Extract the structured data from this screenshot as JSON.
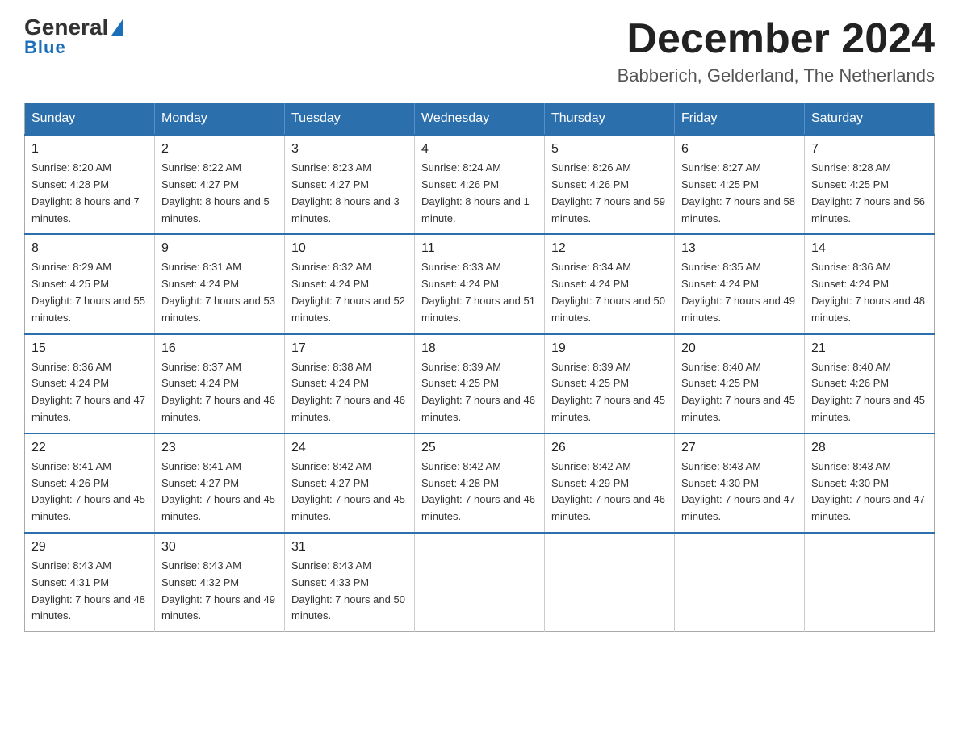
{
  "logo": {
    "general": "General",
    "blue": "Blue",
    "arrow": "▶"
  },
  "title": {
    "month_year": "December 2024",
    "location": "Babberich, Gelderland, The Netherlands"
  },
  "weekdays": [
    "Sunday",
    "Monday",
    "Tuesday",
    "Wednesday",
    "Thursday",
    "Friday",
    "Saturday"
  ],
  "weeks": [
    [
      {
        "day": "1",
        "sunrise": "8:20 AM",
        "sunset": "4:28 PM",
        "daylight": "8 hours and 7 minutes."
      },
      {
        "day": "2",
        "sunrise": "8:22 AM",
        "sunset": "4:27 PM",
        "daylight": "8 hours and 5 minutes."
      },
      {
        "day": "3",
        "sunrise": "8:23 AM",
        "sunset": "4:27 PM",
        "daylight": "8 hours and 3 minutes."
      },
      {
        "day": "4",
        "sunrise": "8:24 AM",
        "sunset": "4:26 PM",
        "daylight": "8 hours and 1 minute."
      },
      {
        "day": "5",
        "sunrise": "8:26 AM",
        "sunset": "4:26 PM",
        "daylight": "7 hours and 59 minutes."
      },
      {
        "day": "6",
        "sunrise": "8:27 AM",
        "sunset": "4:25 PM",
        "daylight": "7 hours and 58 minutes."
      },
      {
        "day": "7",
        "sunrise": "8:28 AM",
        "sunset": "4:25 PM",
        "daylight": "7 hours and 56 minutes."
      }
    ],
    [
      {
        "day": "8",
        "sunrise": "8:29 AM",
        "sunset": "4:25 PM",
        "daylight": "7 hours and 55 minutes."
      },
      {
        "day": "9",
        "sunrise": "8:31 AM",
        "sunset": "4:24 PM",
        "daylight": "7 hours and 53 minutes."
      },
      {
        "day": "10",
        "sunrise": "8:32 AM",
        "sunset": "4:24 PM",
        "daylight": "7 hours and 52 minutes."
      },
      {
        "day": "11",
        "sunrise": "8:33 AM",
        "sunset": "4:24 PM",
        "daylight": "7 hours and 51 minutes."
      },
      {
        "day": "12",
        "sunrise": "8:34 AM",
        "sunset": "4:24 PM",
        "daylight": "7 hours and 50 minutes."
      },
      {
        "day": "13",
        "sunrise": "8:35 AM",
        "sunset": "4:24 PM",
        "daylight": "7 hours and 49 minutes."
      },
      {
        "day": "14",
        "sunrise": "8:36 AM",
        "sunset": "4:24 PM",
        "daylight": "7 hours and 48 minutes."
      }
    ],
    [
      {
        "day": "15",
        "sunrise": "8:36 AM",
        "sunset": "4:24 PM",
        "daylight": "7 hours and 47 minutes."
      },
      {
        "day": "16",
        "sunrise": "8:37 AM",
        "sunset": "4:24 PM",
        "daylight": "7 hours and 46 minutes."
      },
      {
        "day": "17",
        "sunrise": "8:38 AM",
        "sunset": "4:24 PM",
        "daylight": "7 hours and 46 minutes."
      },
      {
        "day": "18",
        "sunrise": "8:39 AM",
        "sunset": "4:25 PM",
        "daylight": "7 hours and 46 minutes."
      },
      {
        "day": "19",
        "sunrise": "8:39 AM",
        "sunset": "4:25 PM",
        "daylight": "7 hours and 45 minutes."
      },
      {
        "day": "20",
        "sunrise": "8:40 AM",
        "sunset": "4:25 PM",
        "daylight": "7 hours and 45 minutes."
      },
      {
        "day": "21",
        "sunrise": "8:40 AM",
        "sunset": "4:26 PM",
        "daylight": "7 hours and 45 minutes."
      }
    ],
    [
      {
        "day": "22",
        "sunrise": "8:41 AM",
        "sunset": "4:26 PM",
        "daylight": "7 hours and 45 minutes."
      },
      {
        "day": "23",
        "sunrise": "8:41 AM",
        "sunset": "4:27 PM",
        "daylight": "7 hours and 45 minutes."
      },
      {
        "day": "24",
        "sunrise": "8:42 AM",
        "sunset": "4:27 PM",
        "daylight": "7 hours and 45 minutes."
      },
      {
        "day": "25",
        "sunrise": "8:42 AM",
        "sunset": "4:28 PM",
        "daylight": "7 hours and 46 minutes."
      },
      {
        "day": "26",
        "sunrise": "8:42 AM",
        "sunset": "4:29 PM",
        "daylight": "7 hours and 46 minutes."
      },
      {
        "day": "27",
        "sunrise": "8:43 AM",
        "sunset": "4:30 PM",
        "daylight": "7 hours and 47 minutes."
      },
      {
        "day": "28",
        "sunrise": "8:43 AM",
        "sunset": "4:30 PM",
        "daylight": "7 hours and 47 minutes."
      }
    ],
    [
      {
        "day": "29",
        "sunrise": "8:43 AM",
        "sunset": "4:31 PM",
        "daylight": "7 hours and 48 minutes."
      },
      {
        "day": "30",
        "sunrise": "8:43 AM",
        "sunset": "4:32 PM",
        "daylight": "7 hours and 49 minutes."
      },
      {
        "day": "31",
        "sunrise": "8:43 AM",
        "sunset": "4:33 PM",
        "daylight": "7 hours and 50 minutes."
      },
      null,
      null,
      null,
      null
    ]
  ],
  "labels": {
    "sunrise": "Sunrise:",
    "sunset": "Sunset:",
    "daylight": "Daylight:"
  }
}
